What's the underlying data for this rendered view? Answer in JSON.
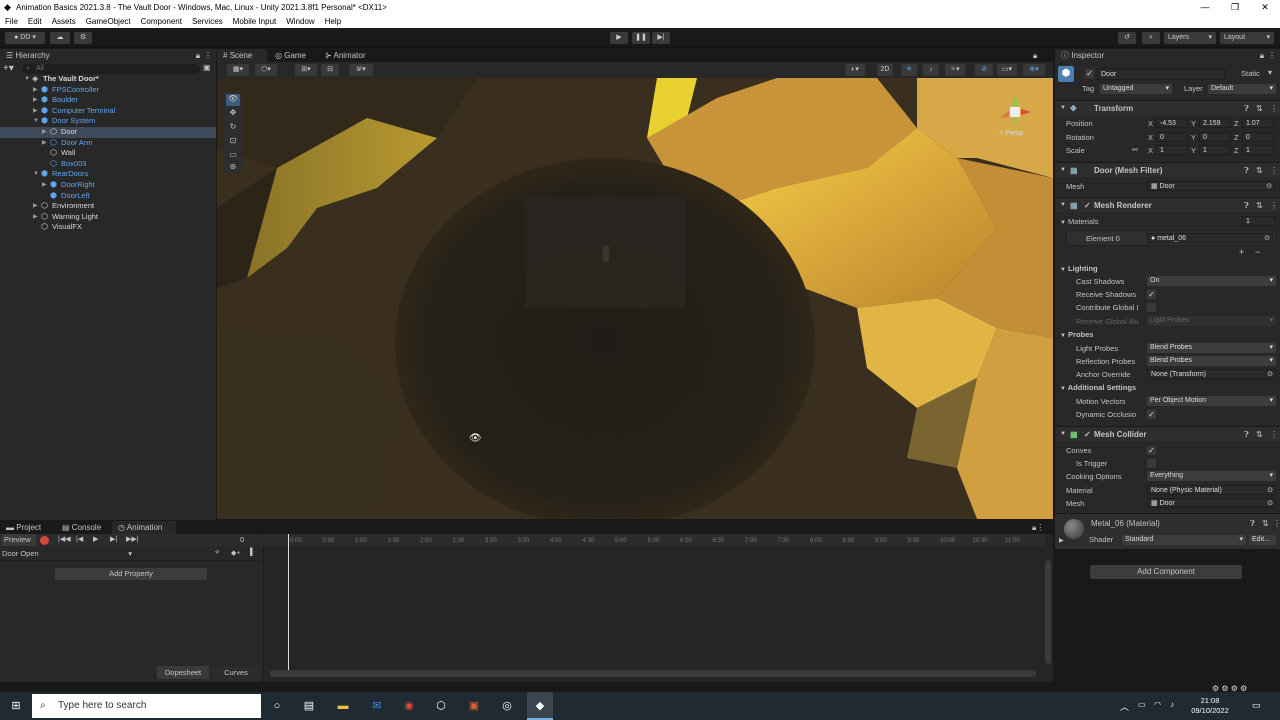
{
  "window": {
    "title": "Animation Basics 2021.3.8 - The Vault Door - Windows, Mac, Linux - Unity 2021.3.8f1 Personal* <DX11>"
  },
  "menu": [
    "File",
    "Edit",
    "Assets",
    "GameObject",
    "Component",
    "Services",
    "Mobile Input",
    "Window",
    "Help"
  ],
  "toolbar": {
    "account": "DD",
    "layers": "Layers",
    "layout": "Layout"
  },
  "hierarchy": {
    "tab": "Hierarchy",
    "search_placeholder": "All",
    "items": [
      {
        "label": "The Vault Door*",
        "depth": 0,
        "color": "white",
        "arrow": "▼",
        "icon": "unity-scene-icon"
      },
      {
        "label": "FPSController",
        "depth": 1,
        "color": "blue",
        "arrow": "▶",
        "icon": "prefab-icon"
      },
      {
        "label": "Boulder",
        "depth": 1,
        "color": "blue",
        "arrow": "▶",
        "icon": "prefab-icon"
      },
      {
        "label": "Computer Terminal",
        "depth": 1,
        "color": "blue",
        "arrow": "▶",
        "icon": "prefab-icon"
      },
      {
        "label": "Door System",
        "depth": 1,
        "color": "blue",
        "arrow": "▼",
        "icon": "prefab-icon"
      },
      {
        "label": "Door",
        "depth": 2,
        "color": "white",
        "arrow": "▶",
        "icon": "cube-icon",
        "selected": true
      },
      {
        "label": "Door Arm",
        "depth": 2,
        "color": "blue",
        "arrow": "▶",
        "icon": "cube-icon"
      },
      {
        "label": "Wall",
        "depth": 2,
        "color": "white",
        "arrow": "",
        "icon": "cube-icon"
      },
      {
        "label": "Box003",
        "depth": 2,
        "color": "blue",
        "arrow": "",
        "icon": "cube-icon"
      },
      {
        "label": "RearDoors",
        "depth": 1,
        "color": "blue",
        "arrow": "▼",
        "icon": "prefab-icon"
      },
      {
        "label": "DoorRight",
        "depth": 2,
        "color": "blue",
        "arrow": "▶",
        "icon": "prefab-icon"
      },
      {
        "label": "DoorLeft",
        "depth": 2,
        "color": "blue",
        "arrow": "",
        "icon": "prefab-icon"
      },
      {
        "label": "Environment",
        "depth": 1,
        "color": "white",
        "arrow": "▶",
        "icon": "gameobject-icon"
      },
      {
        "label": "Warning Light",
        "depth": 1,
        "color": "white",
        "arrow": "▶",
        "icon": "gameobject-icon"
      },
      {
        "label": "VisualFX",
        "depth": 1,
        "color": "white",
        "arrow": "",
        "icon": "gameobject-icon"
      }
    ]
  },
  "scene_tabs": [
    "Scene",
    "Game",
    "Animator"
  ],
  "scene": {
    "gizmo_label": "< Persp",
    "toggle_2d": "2D"
  },
  "inspector": {
    "tab": "Inspector",
    "object_name": "Door",
    "static_label": "Static",
    "tag_label": "Tag",
    "tag_value": "Untagged",
    "layer_label": "Layer",
    "layer_value": "Default",
    "transform": {
      "title": "Transform",
      "position_label": "Position",
      "position": [
        "-4.53",
        "2.159",
        "1.07"
      ],
      "rotation_label": "Rotation",
      "rotation": [
        "0",
        "0",
        "0"
      ],
      "scale_label": "Scale",
      "scale": [
        "1",
        "1",
        "1"
      ],
      "axes": [
        "X",
        "Y",
        "Z"
      ]
    },
    "mesh_filter": {
      "title": "Door (Mesh Filter)",
      "mesh_label": "Mesh",
      "mesh_value": "Door"
    },
    "mesh_renderer": {
      "title": "Mesh Renderer",
      "materials_label": "Materials",
      "materials_count": "1",
      "element0_label": "Element 0",
      "element0_value": "metal_06",
      "lighting_label": "Lighting",
      "cast_shadows_label": "Cast Shadows",
      "cast_shadows_value": "On",
      "receive_shadows_label": "Receive Shadows",
      "contribute_gi_label": "Contribute Global I",
      "receive_gi_label": "Receive Global Illu",
      "receive_gi_value": "Light Probes",
      "probes_label": "Probes",
      "light_probes_label": "Light Probes",
      "light_probes_value": "Blend Probes",
      "reflection_probes_label": "Reflection Probes",
      "reflection_probes_value": "Blend Probes",
      "anchor_override_label": "Anchor Override",
      "anchor_override_value": "None (Transform)",
      "additional_settings_label": "Additional Settings",
      "motion_vectors_label": "Motion Vectors",
      "motion_vectors_value": "Per Object Motion",
      "dynamic_occlusion_label": "Dynamic Occlusio"
    },
    "mesh_collider": {
      "title": "Mesh Collider",
      "convex_label": "Convex",
      "is_trigger_label": "Is Trigger",
      "cooking_options_label": "Cooking Options",
      "cooking_options_value": "Everything",
      "material_label": "Material",
      "material_value": "None (Physic Material)",
      "mesh_label": "Mesh",
      "mesh_value": "Door"
    },
    "material": {
      "title": "Metal_06 (Material)",
      "shader_label": "Shader",
      "shader_value": "Standard",
      "edit_label": "Edit..."
    },
    "add_component": "Add Component"
  },
  "bottom_tabs": [
    "Project",
    "Console",
    "Animation"
  ],
  "animation": {
    "preview_label": "Preview",
    "frame_value": "0",
    "clip_name": "Door Open",
    "add_property": "Add Property",
    "dopesheet": "Dopesheet",
    "curves": "Curves",
    "timeline_ticks": [
      "0:00",
      "0:30",
      "1:00",
      "1:30",
      "2:00",
      "2:30",
      "3:00",
      "3:30",
      "4:00",
      "4:30",
      "5:00",
      "5:30",
      "6:00",
      "6:30",
      "7:00",
      "7:30",
      "8:00",
      "8:30",
      "9:00",
      "9:30",
      "10:00",
      "10:30",
      "11:00"
    ]
  },
  "taskbar": {
    "search_placeholder": "Type here to search",
    "time": "21:08",
    "date": "09/10/2022"
  }
}
